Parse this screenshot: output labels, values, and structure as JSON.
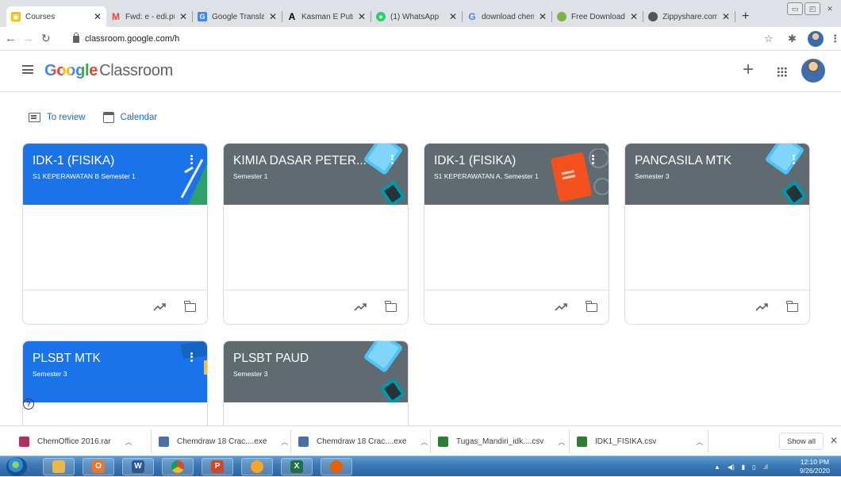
{
  "browser": {
    "tabs": [
      {
        "title": "Courses",
        "favicon": "classroom-icon",
        "favicon_color": "#fbbc04",
        "active": true
      },
      {
        "title": "Fwd: e - edi.put",
        "favicon": "gmail-icon",
        "favicon_color": "#ea4335"
      },
      {
        "title": "Google Transla",
        "favicon": "translate-icon",
        "favicon_color": "#4285f4"
      },
      {
        "title": "Kasman E Putra",
        "favicon": "academia-icon",
        "favicon_color": "#000000"
      },
      {
        "title": "(1) WhatsApp",
        "favicon": "whatsapp-icon",
        "favicon_color": "#25d366"
      },
      {
        "title": "download chem",
        "favicon": "google-icon",
        "favicon_color": "#4285f4"
      },
      {
        "title": "Free Download",
        "favicon": "leaf-icon",
        "favicon_color": "#7cb342"
      },
      {
        "title": "Zippyshare.com",
        "favicon": "globe-icon",
        "favicon_color": "#555555"
      }
    ],
    "new_tab": "+",
    "url": "classroom.google.com/h"
  },
  "app": {
    "logo_google": "Google",
    "logo_product": "Classroom",
    "add_icon": "+",
    "subnav": {
      "to_review": "To review",
      "calendar": "Calendar"
    }
  },
  "courses": [
    {
      "title": "IDK-1 (FISIKA)",
      "section": "S1 KEPERAWATAN B Semester 1",
      "color": "#1a73e8",
      "theme": "pencil"
    },
    {
      "title": "KIMIA DASAR PETER...",
      "section": "Semester 1",
      "color": "#5f6b70",
      "theme": "tablet"
    },
    {
      "title": "IDK-1 (FISIKA)",
      "section": "S1 KEPERAWATAN A, Semester 1",
      "color": "#5f6b70",
      "theme": "book"
    },
    {
      "title": "PANCASILA MTK",
      "section": "Semester 3",
      "color": "#5f6b70",
      "theme": "tablet"
    },
    {
      "title": "PLSBT MTK",
      "section": "Semester 3",
      "color": "#1a73e8",
      "theme": "grad"
    },
    {
      "title": "PLSBT PAUD",
      "section": "Semester 3",
      "color": "#5f6b70",
      "theme": "tablet"
    }
  ],
  "help_icon": "?",
  "downloads": {
    "items": [
      {
        "name": "ChemOffice 2016.rar",
        "icon": "rar-file-icon",
        "color": "#b03060"
      },
      {
        "name": "Chemdraw 18 Crac....exe",
        "icon": "exe-file-icon",
        "color": "#4a6fa5"
      },
      {
        "name": "Chemdraw 18 Crac....exe",
        "icon": "exe-file-icon",
        "color": "#4a6fa5"
      },
      {
        "name": "Tugas_Mandiri_idk....csv",
        "icon": "csv-file-icon",
        "color": "#2e7d32"
      },
      {
        "name": "IDK1_FISIKA.csv",
        "icon": "csv-file-icon",
        "color": "#2e7d32"
      }
    ],
    "show_all": "Show all",
    "close": "✕"
  },
  "taskbar": {
    "apps": [
      {
        "name": "explorer",
        "label": "",
        "color": "#e8b84a"
      },
      {
        "name": "outlook",
        "label": "O",
        "color": "#e8762b"
      },
      {
        "name": "word",
        "label": "W",
        "color": "#2b5797"
      },
      {
        "name": "chrome",
        "label": "",
        "color": "#db4437"
      },
      {
        "name": "powerpoint",
        "label": "P",
        "color": "#d24726"
      },
      {
        "name": "app-orange",
        "label": "",
        "color": "#f5a623"
      },
      {
        "name": "excel",
        "label": "X",
        "color": "#1e7145"
      },
      {
        "name": "firefox",
        "label": "",
        "color": "#e66000"
      }
    ],
    "time": "12:10 PM",
    "date": "9/26/2020"
  }
}
